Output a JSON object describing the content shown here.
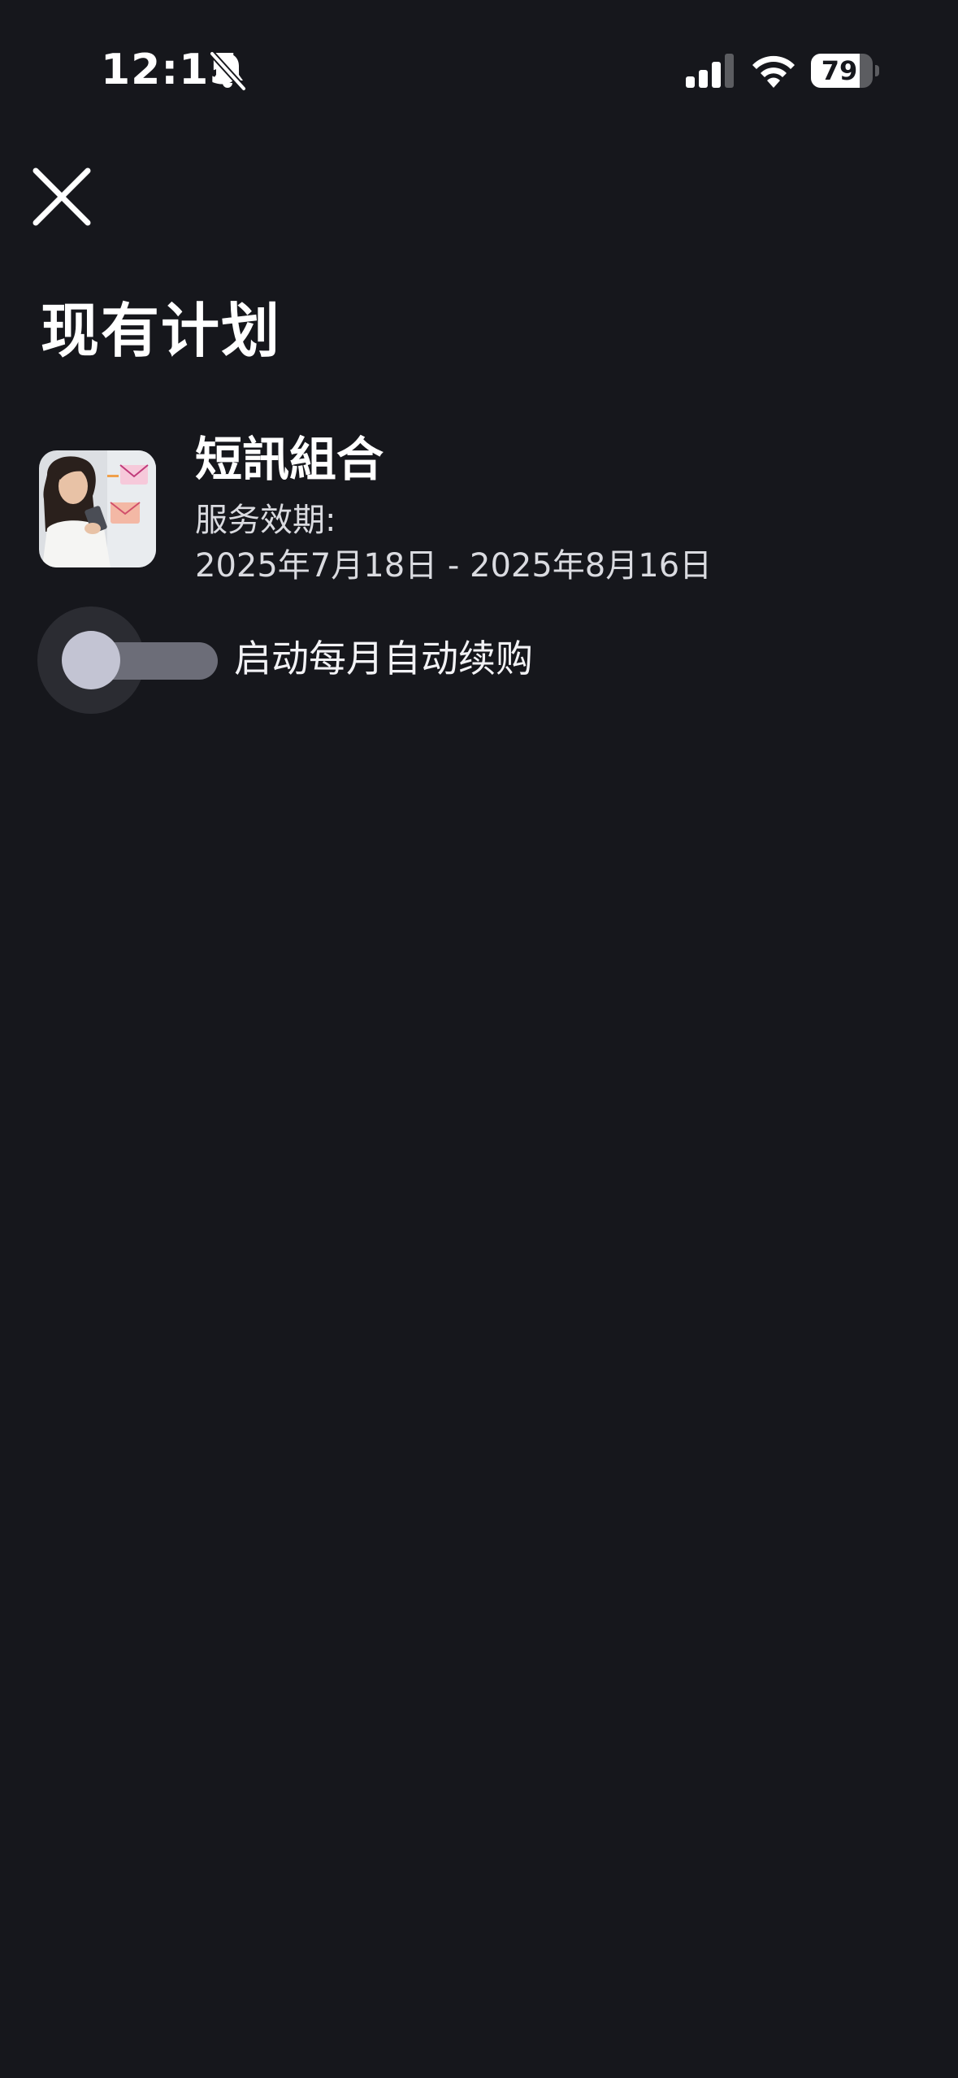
{
  "status_bar": {
    "time": "12:15",
    "battery_level": "79",
    "battery_fraction": 0.79,
    "icons": [
      "bell-off-icon",
      "signal-icon",
      "wifi-icon",
      "battery-icon"
    ]
  },
  "header": {
    "close_icon": "close-icon"
  },
  "page": {
    "title": "现有计划"
  },
  "plan": {
    "name": "短訊組合",
    "period_label": "服务效期:",
    "period_range": "2025年7月18日 - 2025年8月16日"
  },
  "auto_renew": {
    "label": "启动每月自动续购",
    "enabled": false
  },
  "colors": {
    "background": "#16171c",
    "text_primary": "#ffffff",
    "text_secondary": "#dadbe0",
    "toggle_track": "#6c6d78",
    "toggle_thumb": "#c3c4d3"
  }
}
